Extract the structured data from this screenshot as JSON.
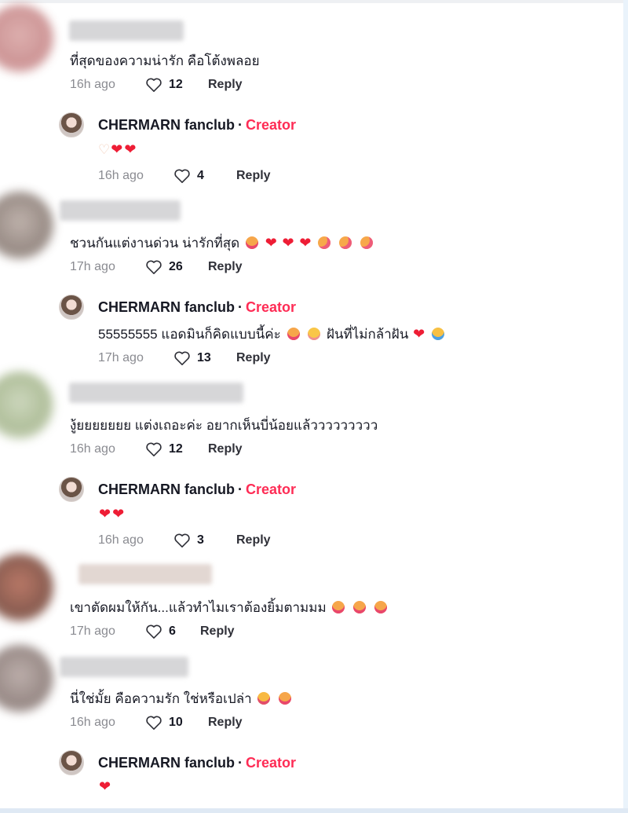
{
  "comments": [
    {
      "text": "ที่สุดของความน่ารัก คือโต้งพลอย",
      "time": "16h ago",
      "likes": "12",
      "reply_label": "Reply",
      "reply": {
        "author": "CHERMARN fanclub",
        "badge": "Creator",
        "text": "",
        "time": "16h ago",
        "likes": "4",
        "reply_label": "Reply"
      }
    },
    {
      "text": "ชวนกันแต่งานด่วน น่ารักที่สุด",
      "time": "17h ago",
      "likes": "26",
      "reply_label": "Reply",
      "reply": {
        "author": "CHERMARN fanclub",
        "badge": "Creator",
        "text": "55555555 แอดมินก็คิดแบบนี้ค่ะ",
        "text_tail": "ฝันที่ไม่กล้าฝัน",
        "time": "17h ago",
        "likes": "13",
        "reply_label": "Reply"
      }
    },
    {
      "text": "งู้ยยยยยยย แต่งเถอะค่ะ อยากเห็นบี่น้อยแล้ววววววววว",
      "time": "16h ago",
      "likes": "12",
      "reply_label": "Reply",
      "reply": {
        "author": "CHERMARN fanclub",
        "badge": "Creator",
        "text": "",
        "time": "16h ago",
        "likes": "3",
        "reply_label": "Reply"
      }
    },
    {
      "text": "เขาตัดผมให้กัน...แล้วทำไมเราต้องยิ้มตามมม",
      "time": "17h ago",
      "likes": "6",
      "reply_label": "Reply"
    },
    {
      "text": "นี่ใช่มั้ย คือความรัก ใช่หรือเปล่า",
      "time": "16h ago",
      "likes": "10",
      "reply_label": "Reply",
      "reply": {
        "author": "CHERMARN fanclub",
        "badge": "Creator",
        "text": ""
      }
    }
  ],
  "separator": "·",
  "colors": {
    "creator_badge": "#fe2c55",
    "time": "#8a8b91",
    "heart": "#ee1d35"
  }
}
